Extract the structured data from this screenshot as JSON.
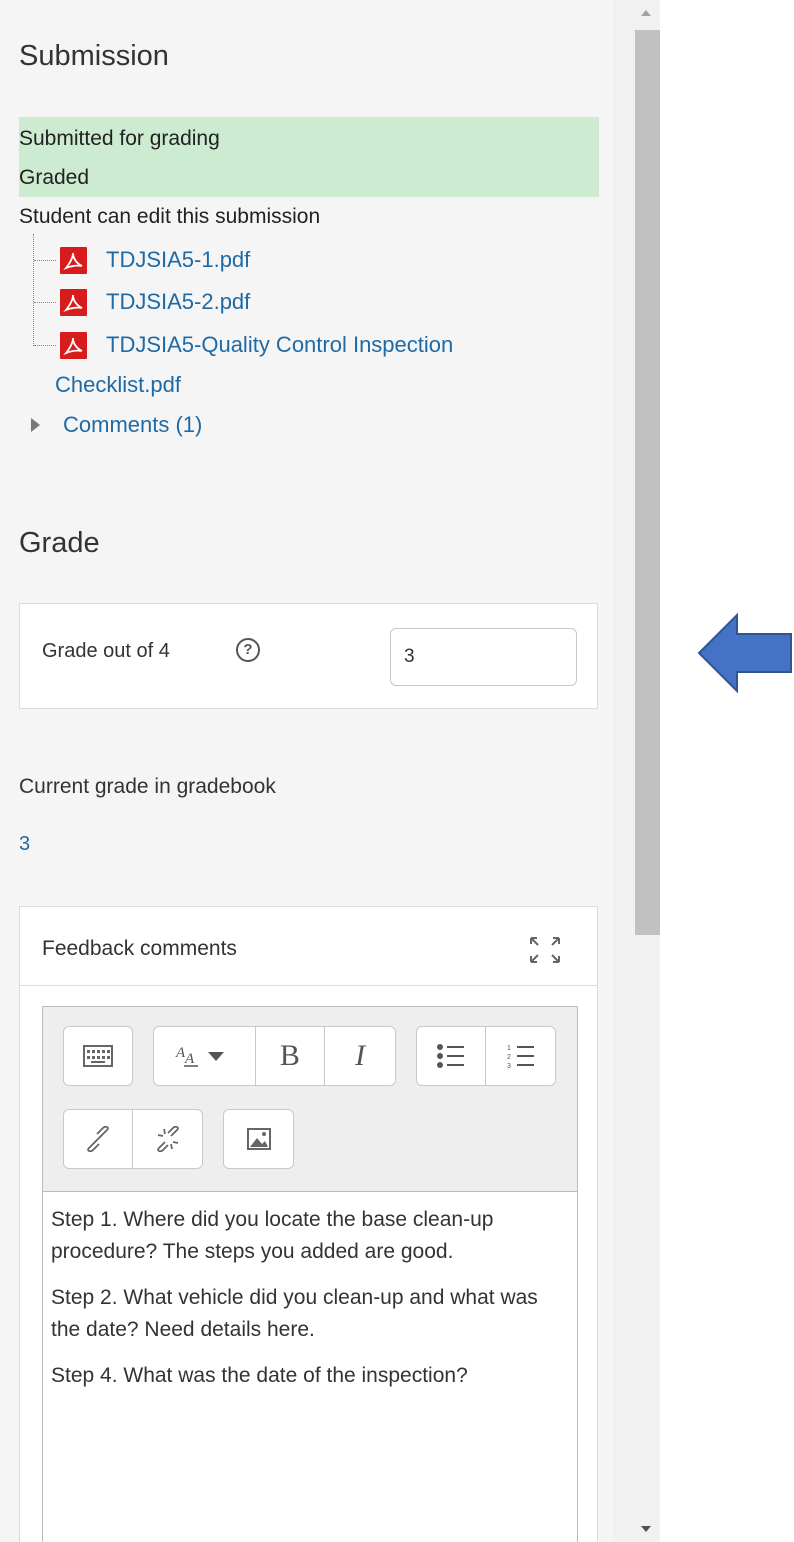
{
  "submission": {
    "title": "Submission",
    "status_submitted": "Submitted for grading",
    "status_graded": "Graded",
    "edit_note": "Student can edit this submission",
    "files": [
      "TDJSIA5-1.pdf",
      "TDJSIA5-2.pdf",
      "TDJSIA5-Quality Control Inspection",
      "Checklist.pdf"
    ],
    "comments_label": "Comments (1)"
  },
  "grade": {
    "title": "Grade",
    "label": "Grade out of 4",
    "help_icon": "?",
    "value": "3",
    "current_label": "Current grade in gradebook",
    "current_value": "3"
  },
  "feedback": {
    "title": "Feedback comments",
    "toolbar": {
      "bold": "B",
      "italic": "I"
    },
    "paragraphs": [
      "Step 1.  Where did you locate the base clean-up procedure?  The steps you added are good.",
      "Step 2. What vehicle did you clean-up and what was the date?   Need details here.",
      "Step 4.  What was the date of the inspection?"
    ]
  },
  "colors": {
    "status_bg": "#cdebd0",
    "link": "#1f6aa5",
    "arrow": "#4472c4",
    "pdf_icon": "#d81b1b"
  }
}
